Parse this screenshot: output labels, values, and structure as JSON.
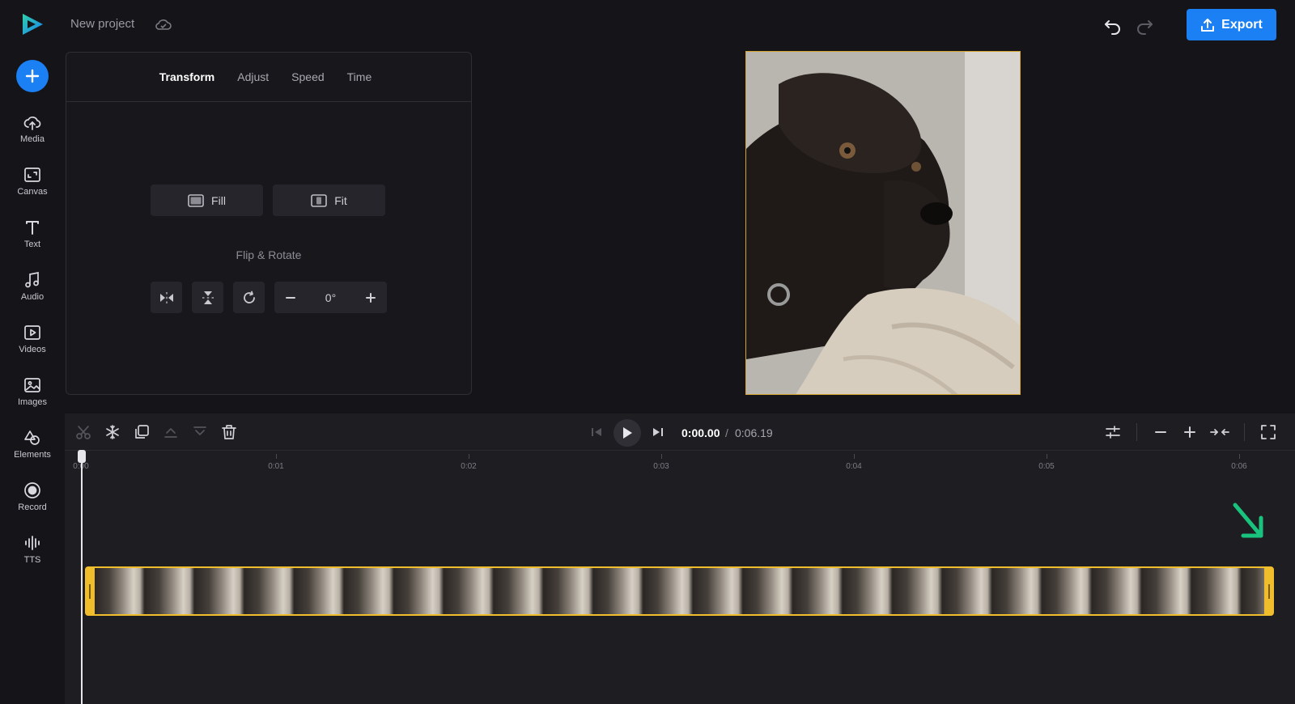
{
  "header": {
    "project_name": "New project",
    "export_label": "Export"
  },
  "sidebar": {
    "items": [
      {
        "label": "Media",
        "icon": "upload-cloud-icon"
      },
      {
        "label": "Canvas",
        "icon": "canvas-icon"
      },
      {
        "label": "Text",
        "icon": "text-icon"
      },
      {
        "label": "Audio",
        "icon": "music-note-icon"
      },
      {
        "label": "Videos",
        "icon": "video-icon"
      },
      {
        "label": "Images",
        "icon": "image-icon"
      },
      {
        "label": "Elements",
        "icon": "shapes-icon"
      },
      {
        "label": "Record",
        "icon": "record-icon"
      },
      {
        "label": "TTS",
        "icon": "waveform-icon"
      }
    ]
  },
  "panel": {
    "tabs": [
      "Transform",
      "Adjust",
      "Speed",
      "Time"
    ],
    "active_tab": "Transform",
    "fill_label": "Fill",
    "fit_label": "Fit",
    "flip_rotate_title": "Flip & Rotate",
    "rotation_value": "0°"
  },
  "timeline": {
    "current_time": "0:00.00",
    "separator": "/",
    "total_time": "0:06.19",
    "ruler_labels": [
      "0:00",
      "0:01",
      "0:02",
      "0:03",
      "0:04",
      "0:05",
      "0:06"
    ]
  },
  "colors": {
    "accent": "#1a80f3",
    "clip_border": "#f0bd2c",
    "hint_arrow": "#19c37d"
  }
}
